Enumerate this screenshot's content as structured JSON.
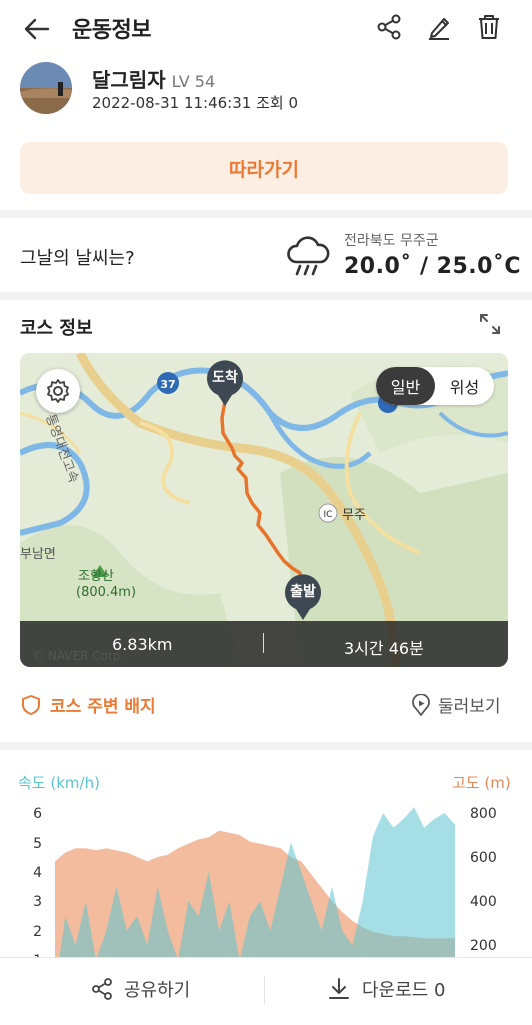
{
  "header": {
    "title": "운동정보"
  },
  "profile": {
    "name": "달그림자",
    "level": "LV 54",
    "meta": "2022-08-31 11:46:31 조회 0",
    "follow_label": "따라가기"
  },
  "weather": {
    "question": "그날의 날씨는?",
    "location": "전라북도 무주군",
    "temperature": "20.0˚ / 25.0˚C",
    "icon": "rain-cloud-icon"
  },
  "course": {
    "title": "코스 정보",
    "map_mode_normal": "일반",
    "map_mode_satellite": "위성",
    "end_label": "도착",
    "start_label": "출발",
    "distance": "6.83km",
    "duration": "3시간 46분",
    "map_labels": {
      "road_number": "37",
      "ic": "IC",
      "muju": "무주",
      "mountain": "조항산",
      "mountain_height": "(800.4m)",
      "region": "부남면",
      "expressway": "통영대전고속",
      "attribution": "© NAVER Corp."
    },
    "badge_label": "코스 주변 배지",
    "lookaround_label": "둘러보기"
  },
  "chart_data": {
    "type": "area",
    "speed_label": "속도 (km/h)",
    "altitude_label": "고도 (m)",
    "speed_ticks": [
      "6",
      "5",
      "4",
      "3",
      "2",
      "1"
    ],
    "altitude_ticks": [
      "800",
      "600",
      "400",
      "200"
    ],
    "speed_color": "#5bc5cf",
    "altitude_color": "#f0a57e",
    "altitude_series": [
      580,
      620,
      640,
      640,
      630,
      640,
      630,
      620,
      600,
      580,
      600,
      610,
      640,
      660,
      680,
      690,
      720,
      710,
      700,
      670,
      660,
      650,
      640,
      600,
      580,
      520,
      460,
      400,
      350,
      310,
      280,
      260,
      250,
      240,
      240,
      235,
      230,
      230,
      230,
      230
    ],
    "speed_series": [
      0,
      2.5,
      1.5,
      3,
      1,
      2,
      3.5,
      2,
      2.5,
      1.5,
      3.5,
      2,
      1,
      3,
      2.5,
      4,
      2,
      3,
      1,
      2.5,
      3,
      2,
      3.5,
      5,
      4,
      3,
      2,
      3.5,
      2,
      1.5,
      3,
      5.2,
      6,
      5.5,
      5.8,
      6.2,
      5.5,
      5.8,
      6,
      5.6
    ]
  },
  "bottom": {
    "share_label": "공유하기",
    "download_label": "다운로드 0"
  }
}
